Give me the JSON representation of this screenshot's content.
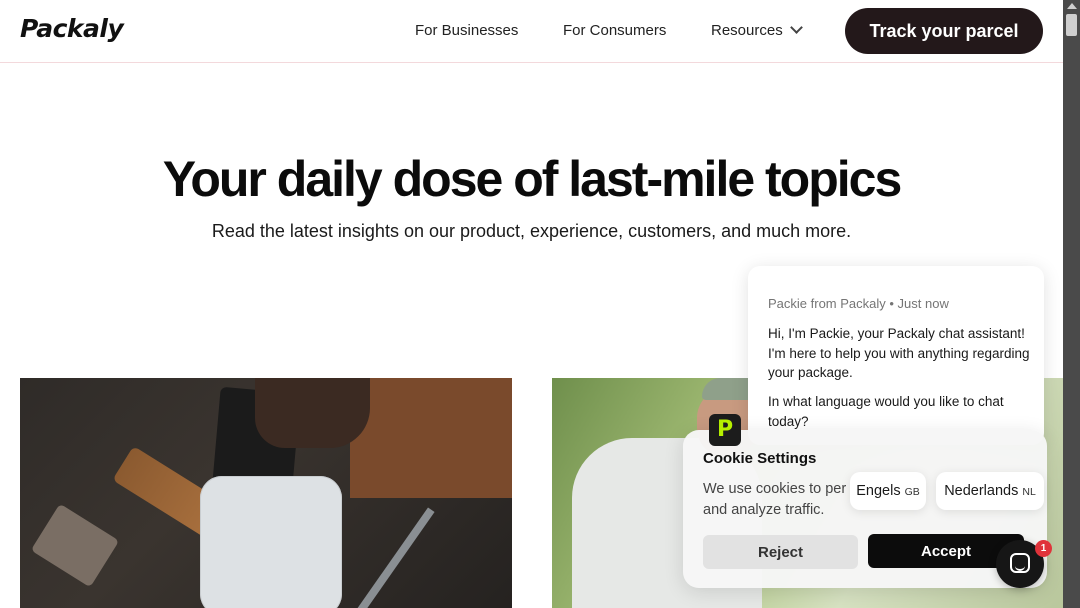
{
  "header": {
    "logo_text": "Packaly",
    "nav": [
      {
        "label": "For Businesses"
      },
      {
        "label": "For Consumers"
      },
      {
        "label": "Resources"
      }
    ],
    "track_button_label": "Track your parcel"
  },
  "hero": {
    "title": "Your daily dose of last-mile topics",
    "subtitle": "Read the latest insights on our product, experience, customers, and much more."
  },
  "chat": {
    "meta": "Packie from Packaly • Just now",
    "message_1": "Hi, I'm Packie, your Packaly chat assistant! I'm here to help you with anything regarding your package.",
    "message_2": "In what language would you like to chat today?",
    "options": [
      {
        "label": "Engels",
        "code": "GB"
      },
      {
        "label": "Nederlands",
        "code": "NL"
      }
    ],
    "unread_count": "1"
  },
  "cookie": {
    "logo_letter": "P",
    "title": "Cookie Settings",
    "text": "We use cookies to per... nt and analyze traffic.",
    "text_line_1": "We use cookies to per",
    "text_line_1_tail": "nt",
    "text_line_2": "and analyze traffic.",
    "reject_label": "Reject",
    "accept_label": "Accept"
  },
  "colors": {
    "track_button_bg": "#23181a",
    "accept_bg": "#0c0c0c",
    "badge": "#e0333a",
    "brand_green": "#b6f000"
  }
}
